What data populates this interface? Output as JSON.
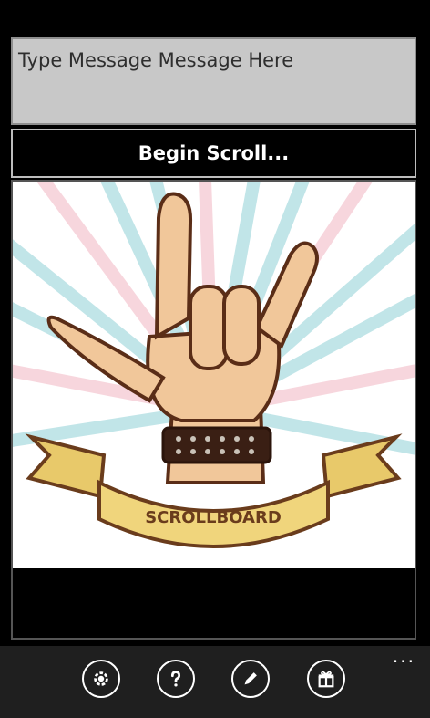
{
  "message": {
    "text": "Type Message Message Here"
  },
  "scroll_button": {
    "label": "Begin Scroll..."
  },
  "artwork": {
    "banner_text": "SCROLLBOARD"
  },
  "appbar": {
    "buttons": [
      {
        "icon": "gear-icon"
      },
      {
        "icon": "question-icon"
      },
      {
        "icon": "pencil-icon"
      },
      {
        "icon": "gift-icon"
      }
    ],
    "more": "..."
  }
}
